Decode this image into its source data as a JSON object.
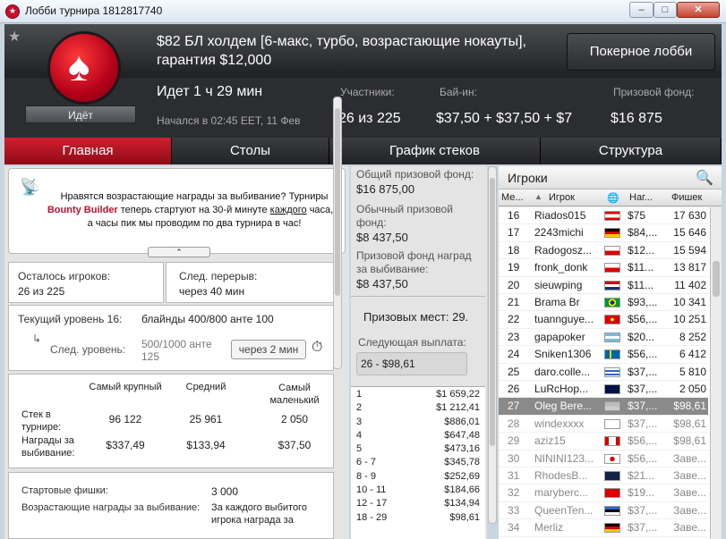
{
  "window": {
    "title": "Лобби турнира 1812817740"
  },
  "header": {
    "tournament_name": "$82 БЛ холдем [6-макс, турбо, возрастающие нокауты], гарантия $12,000",
    "status": "Идёт",
    "lobby_button": "Покерное лобби",
    "running": "Идет 1 ч 29 мин",
    "started": "Начался в 02:45 EET, 11 Фев",
    "participants_label": "Участники:",
    "participants_value": "26 из 225",
    "buyin_label": "Бай-ин:",
    "buyin_value": "$37,50 + $37,50 + $7",
    "prize_label": "Призовой фонд:",
    "prize_value": "$16 875"
  },
  "tabs": [
    "Главная",
    "Столы",
    "График стеков",
    "Структура"
  ],
  "promo": {
    "line1": "Нравятся возрастающие награды за выбивание? Турниры",
    "bold": "Bounty Builder",
    "line2a": " теперь стартуют на 30-й минуте ",
    "underline": "каждого",
    "line2b": " часа, в а часы пик мы проводим по два турнира в час!"
  },
  "stats": {
    "players_left_label": "Осталось игроков:",
    "players_left_value": "26 из 225",
    "next_break_label": "След. перерыв:",
    "next_break_value": "через 40 мин",
    "current_level_label": "Текущий уровень 16:",
    "current_level_value": "блайнды 400/800 анте 100",
    "next_level_label": "След. уровень:",
    "next_level_value": "500/1000 анте 125",
    "next_level_timer": "через 2 мин"
  },
  "stack_table": {
    "headers": [
      "Самый крупный",
      "Средний",
      "Самый маленький"
    ],
    "rows": [
      {
        "label": "Стек в турнире:",
        "values": [
          "96 122",
          "25 961",
          "2 050"
        ]
      },
      {
        "label": "Награды за выбивание:",
        "values": [
          "$337,49",
          "$133,94",
          "$37,50"
        ]
      }
    ]
  },
  "chips": {
    "start_label": "Стартовые фишки:",
    "start_value": "3 000",
    "bounty_label": "Возрастающие награды за выбивание:",
    "bounty_value": "За каждого выбитого игрока награда за"
  },
  "middle": {
    "total_label": "Общий призовой фонд:",
    "total_value": "$16 875,00",
    "regular_label": "Обычный призовой фонд:",
    "regular_value": "$8 437,50",
    "bounty_fund_label": "Призовой фонд наград за выбивание:",
    "bounty_fund_value": "$8 437,50",
    "paid_places": "Призовых мест: 29.",
    "next_payout_label": "Следующая выплата:",
    "next_payout_value": "26 - $98,61",
    "payouts": [
      [
        "1",
        "$1 659,22"
      ],
      [
        "2",
        "$1 212,41"
      ],
      [
        "3",
        "$886,01"
      ],
      [
        "4",
        "$647,48"
      ],
      [
        "5",
        "$473,16"
      ],
      [
        "6 - 7",
        "$345,78"
      ],
      [
        "8 - 9",
        "$252,69"
      ],
      [
        "10 - 11",
        "$184,66"
      ],
      [
        "12 - 17",
        "$134,94"
      ],
      [
        "18 - 29",
        "$98,61"
      ]
    ]
  },
  "players": {
    "title": "Игроки",
    "columns": [
      "Ме...",
      "Игрок",
      "Наг...",
      "Фишек"
    ],
    "rows": [
      {
        "pos": "16",
        "name": "Riados015",
        "bounty": "$75",
        "chips": "17 630",
        "flag": "lb"
      },
      {
        "pos": "17",
        "name": "2243michi",
        "bounty": "$84,...",
        "chips": "15 646",
        "flag": "de"
      },
      {
        "pos": "18",
        "name": "Radogosz...",
        "bounty": "$12...",
        "chips": "15 594",
        "flag": "pl"
      },
      {
        "pos": "19",
        "name": "fronk_donk",
        "bounty": "$11...",
        "chips": "13 817",
        "flag": "pl"
      },
      {
        "pos": "20",
        "name": "sieuwping",
        "bounty": "$11...",
        "chips": "11 402",
        "flag": "nl"
      },
      {
        "pos": "21",
        "name": "Brama Br",
        "bounty": "$93,...",
        "chips": "10 341",
        "flag": "br"
      },
      {
        "pos": "22",
        "name": "tuannguye...",
        "bounty": "$56,...",
        "chips": "10 251",
        "flag": "vn"
      },
      {
        "pos": "23",
        "name": "gapapoker",
        "bounty": "$20...",
        "chips": "8 252",
        "flag": "ar"
      },
      {
        "pos": "24",
        "name": "Sniken1306",
        "bounty": "$56,...",
        "chips": "6 412",
        "flag": "se"
      },
      {
        "pos": "25",
        "name": "daro.colle...",
        "bounty": "$37,...",
        "chips": "5 810",
        "flag": "uy"
      },
      {
        "pos": "26",
        "name": "LuRcHop...",
        "bounty": "$37,...",
        "chips": "2 050",
        "flag": "au"
      },
      {
        "pos": "27",
        "name": "Oleg Bere...",
        "bounty": "$37,...",
        "chips": "$98,61",
        "flag": "ua",
        "sel": true
      },
      {
        "pos": "28",
        "name": "windexxxx",
        "bounty": "$37,...",
        "chips": "$98,61",
        "flag": "xx",
        "out": true
      },
      {
        "pos": "29",
        "name": "aziz15",
        "bounty": "$56,...",
        "chips": "$98,61",
        "flag": "ca",
        "out": true
      },
      {
        "pos": "30",
        "name": "NININI123...",
        "bounty": "$56,...",
        "chips": "Заве...",
        "flag": "jp",
        "out": true
      },
      {
        "pos": "31",
        "name": "RhodesB...",
        "bounty": "$21...",
        "chips": "Заве...",
        "flag": "gb",
        "out": true
      },
      {
        "pos": "32",
        "name": "maryberc...",
        "bounty": "$19...",
        "chips": "Заве...",
        "flag": "ch",
        "out": true
      },
      {
        "pos": "33",
        "name": "QueenTen...",
        "bounty": "$37,...",
        "chips": "Заве...",
        "flag": "ee",
        "out": true
      },
      {
        "pos": "34",
        "name": "Merliz",
        "bounty": "$37,...",
        "chips": "Заве...",
        "flag": "de2",
        "out": true
      }
    ]
  },
  "colors": {
    "accent": "#c8102e",
    "header_bg": "#2b2d30",
    "selected_row": "#8a8a8a"
  }
}
